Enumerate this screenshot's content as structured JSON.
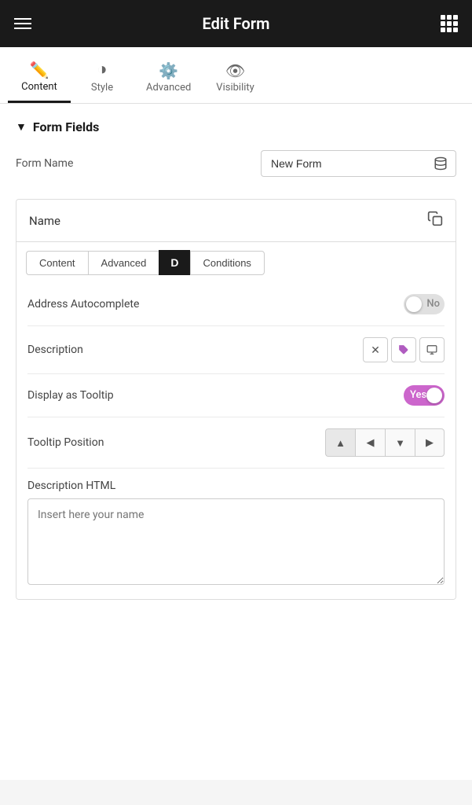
{
  "header": {
    "title": "Edit Form",
    "hamburger_label": "Menu",
    "grid_label": "Apps"
  },
  "tabs": [
    {
      "id": "content",
      "label": "Content",
      "icon": "✏️",
      "active": true
    },
    {
      "id": "style",
      "label": "Style",
      "icon": "◑"
    },
    {
      "id": "advanced",
      "label": "Advanced",
      "icon": "⚙️"
    },
    {
      "id": "visibility",
      "label": "Visibility",
      "icon": "👁"
    }
  ],
  "section": {
    "title": "Form Fields"
  },
  "form_name": {
    "label": "Form Name",
    "value": "New Form",
    "db_icon": "database"
  },
  "name_card": {
    "title": "Name",
    "copy_icon": "copy"
  },
  "sub_tabs": [
    {
      "id": "content",
      "label": "Content"
    },
    {
      "id": "advanced",
      "label": "Advanced"
    },
    {
      "id": "d",
      "label": "D"
    },
    {
      "id": "conditions",
      "label": "Conditions"
    }
  ],
  "fields": {
    "address_autocomplete": {
      "label": "Address Autocomplete",
      "toggle_state": "off",
      "toggle_text": "No"
    },
    "description": {
      "label": "Description",
      "x_icon": "×",
      "tag_icon": "tag",
      "download_icon": "download"
    },
    "display_as_tooltip": {
      "label": "Display as Tooltip",
      "toggle_state": "on",
      "toggle_text": "Yes"
    },
    "tooltip_position": {
      "label": "Tooltip Position",
      "buttons": [
        "▲",
        "◀",
        "▼",
        "▶"
      ]
    },
    "description_html": {
      "label": "Description HTML",
      "placeholder": "Insert here your name"
    }
  }
}
